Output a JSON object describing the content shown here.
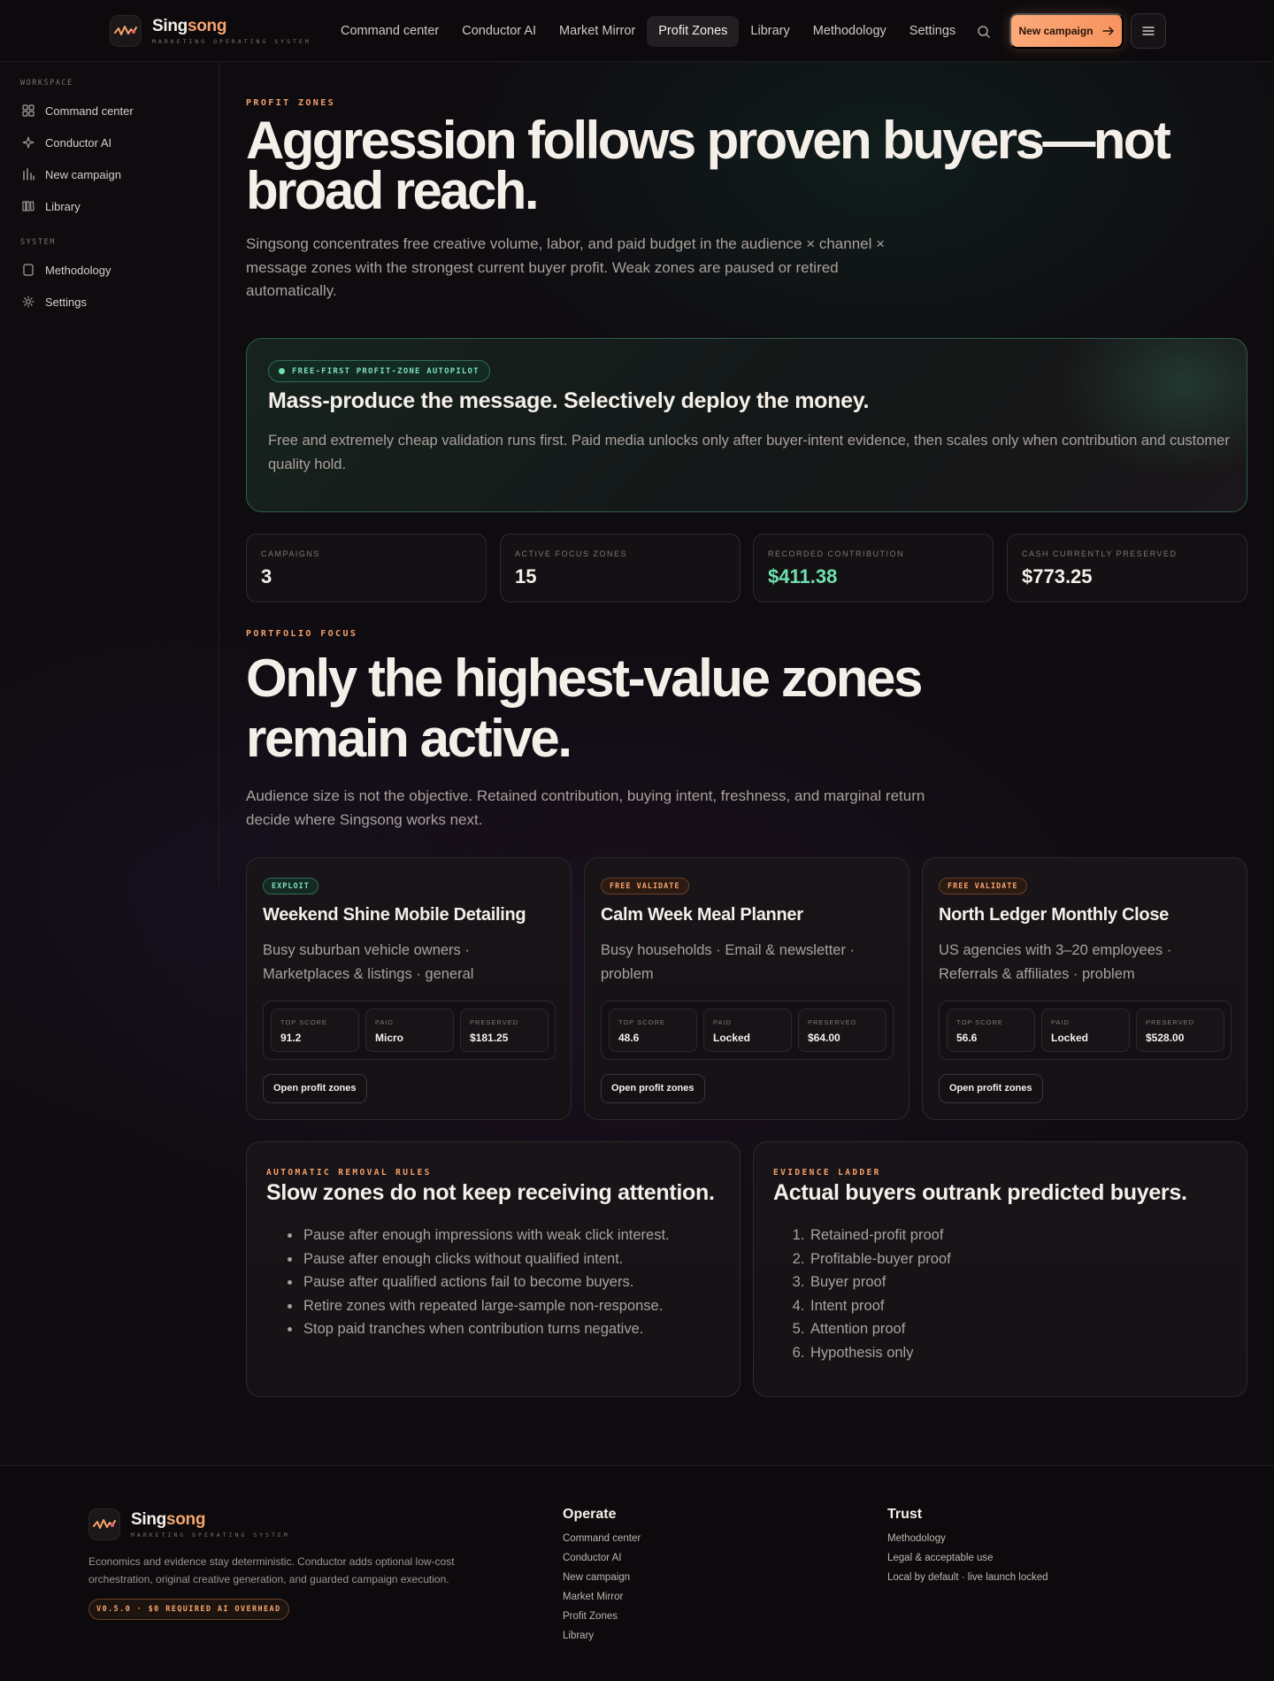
{
  "brand": {
    "name_part1": "Sing",
    "name_part2": "song",
    "tagline": "MARKETING OPERATING SYSTEM"
  },
  "nav": {
    "items": [
      {
        "label": "Command center"
      },
      {
        "label": "Conductor AI"
      },
      {
        "label": "Market Mirror"
      },
      {
        "label": "Profit Zones",
        "active": true
      },
      {
        "label": "Library"
      },
      {
        "label": "Methodology"
      },
      {
        "label": "Settings"
      }
    ],
    "cta_label": "New campaign"
  },
  "sidebar": {
    "workspace_label": "WORKSPACE",
    "workspace_items": [
      {
        "label": "Command center",
        "icon": "grid-icon"
      },
      {
        "label": "Conductor AI",
        "icon": "sparkle-icon"
      },
      {
        "label": "New campaign",
        "icon": "bar-chart-icon"
      },
      {
        "label": "Library",
        "icon": "books-icon"
      }
    ],
    "system_label": "SYSTEM",
    "system_items": [
      {
        "label": "Methodology",
        "icon": "document-icon"
      },
      {
        "label": "Settings",
        "icon": "gear-icon"
      }
    ]
  },
  "hero": {
    "eyebrow": "PROFIT ZONES",
    "title": "Aggression follows proven buyers—not broad reach.",
    "description": "Singsong concentrates free creative volume, labor, and paid budget in the audience × channel × message zones with the strongest current buyer profit. Weak zones are paused or retired automatically."
  },
  "autopilot": {
    "badge": "FREE-FIRST PROFIT-ZONE AUTOPILOT",
    "title": "Mass-produce the message. Selectively deploy the money.",
    "description": "Free and extremely cheap validation runs first. Paid media unlocks only after buyer-intent evidence, then scales only when contribution and customer quality hold."
  },
  "stats": [
    {
      "label": "CAMPAIGNS",
      "value": "3"
    },
    {
      "label": "ACTIVE FOCUS ZONES",
      "value": "15"
    },
    {
      "label": "RECORDED CONTRIBUTION",
      "value": "$411.38",
      "accent": "#6fe0b0"
    },
    {
      "label": "CASH CURRENTLY PRESERVED",
      "value": "$773.25"
    }
  ],
  "portfolio": {
    "eyebrow": "PORTFOLIO FOCUS",
    "title": "Only the highest-value zones remain active.",
    "description": "Audience size is not the objective. Retained contribution, buying intent, freshness, and marginal return decide where Singsong works next."
  },
  "zones": [
    {
      "tag": "EXPLOIT",
      "name": "Weekend Shine Mobile Detailing",
      "audience": "Busy suburban vehicle owners · Marketplaces & listings · general",
      "metrics": [
        {
          "label": "TOP SCORE",
          "value": "91.2"
        },
        {
          "label": "PAID",
          "value": "Micro"
        },
        {
          "label": "PRESERVED",
          "value": "$181.25"
        }
      ],
      "button": "Open profit zones"
    },
    {
      "tag": "FREE VALIDATE",
      "name": "Calm Week Meal Planner",
      "audience": "Busy households · Email & newsletter · problem",
      "metrics": [
        {
          "label": "TOP SCORE",
          "value": "48.6"
        },
        {
          "label": "PAID",
          "value": "Locked"
        },
        {
          "label": "PRESERVED",
          "value": "$64.00"
        }
      ],
      "button": "Open profit zones"
    },
    {
      "tag": "FREE VALIDATE",
      "name": "North Ledger Monthly Close",
      "audience": "US agencies with 3–20 employees · Referrals & affiliates · problem",
      "metrics": [
        {
          "label": "TOP SCORE",
          "value": "56.6"
        },
        {
          "label": "PAID",
          "value": "Locked"
        },
        {
          "label": "PRESERVED",
          "value": "$528.00"
        }
      ],
      "button": "Open profit zones"
    }
  ],
  "removal_rules": {
    "eyebrow": "AUTOMATIC REMOVAL RULES",
    "title": "Slow zones do not keep receiving attention.",
    "items": [
      "Pause after enough impressions with weak click interest.",
      "Pause after enough clicks without qualified intent.",
      "Pause after qualified actions fail to become buyers.",
      "Retire zones with repeated large-sample non-response.",
      "Stop paid tranches when contribution turns negative."
    ]
  },
  "evidence_ladder": {
    "eyebrow": "EVIDENCE LADDER",
    "title": "Actual buyers outrank predicted buyers.",
    "items": [
      "Retained-profit proof",
      "Profitable-buyer proof",
      "Buyer proof",
      "Intent proof",
      "Attention proof",
      "Hypothesis only"
    ]
  },
  "footer": {
    "description": "Economics and evidence stay deterministic. Conductor adds optional low-cost orchestration, original creative generation, and guarded campaign execution.",
    "version": "V0.5.0 · $0 REQUIRED AI OVERHEAD",
    "operate_title": "Operate",
    "operate_links": [
      "Command center",
      "Conductor AI",
      "New campaign",
      "Market Mirror",
      "Profit Zones",
      "Library"
    ],
    "trust_title": "Trust",
    "trust_links": [
      "Methodology",
      "Legal & acceptable use",
      "Local by default · live launch locked"
    ]
  },
  "colors": {
    "accent_orange": "#f7a46d",
    "accent_green": "#6fe0b0",
    "background": "#0f0c10"
  }
}
